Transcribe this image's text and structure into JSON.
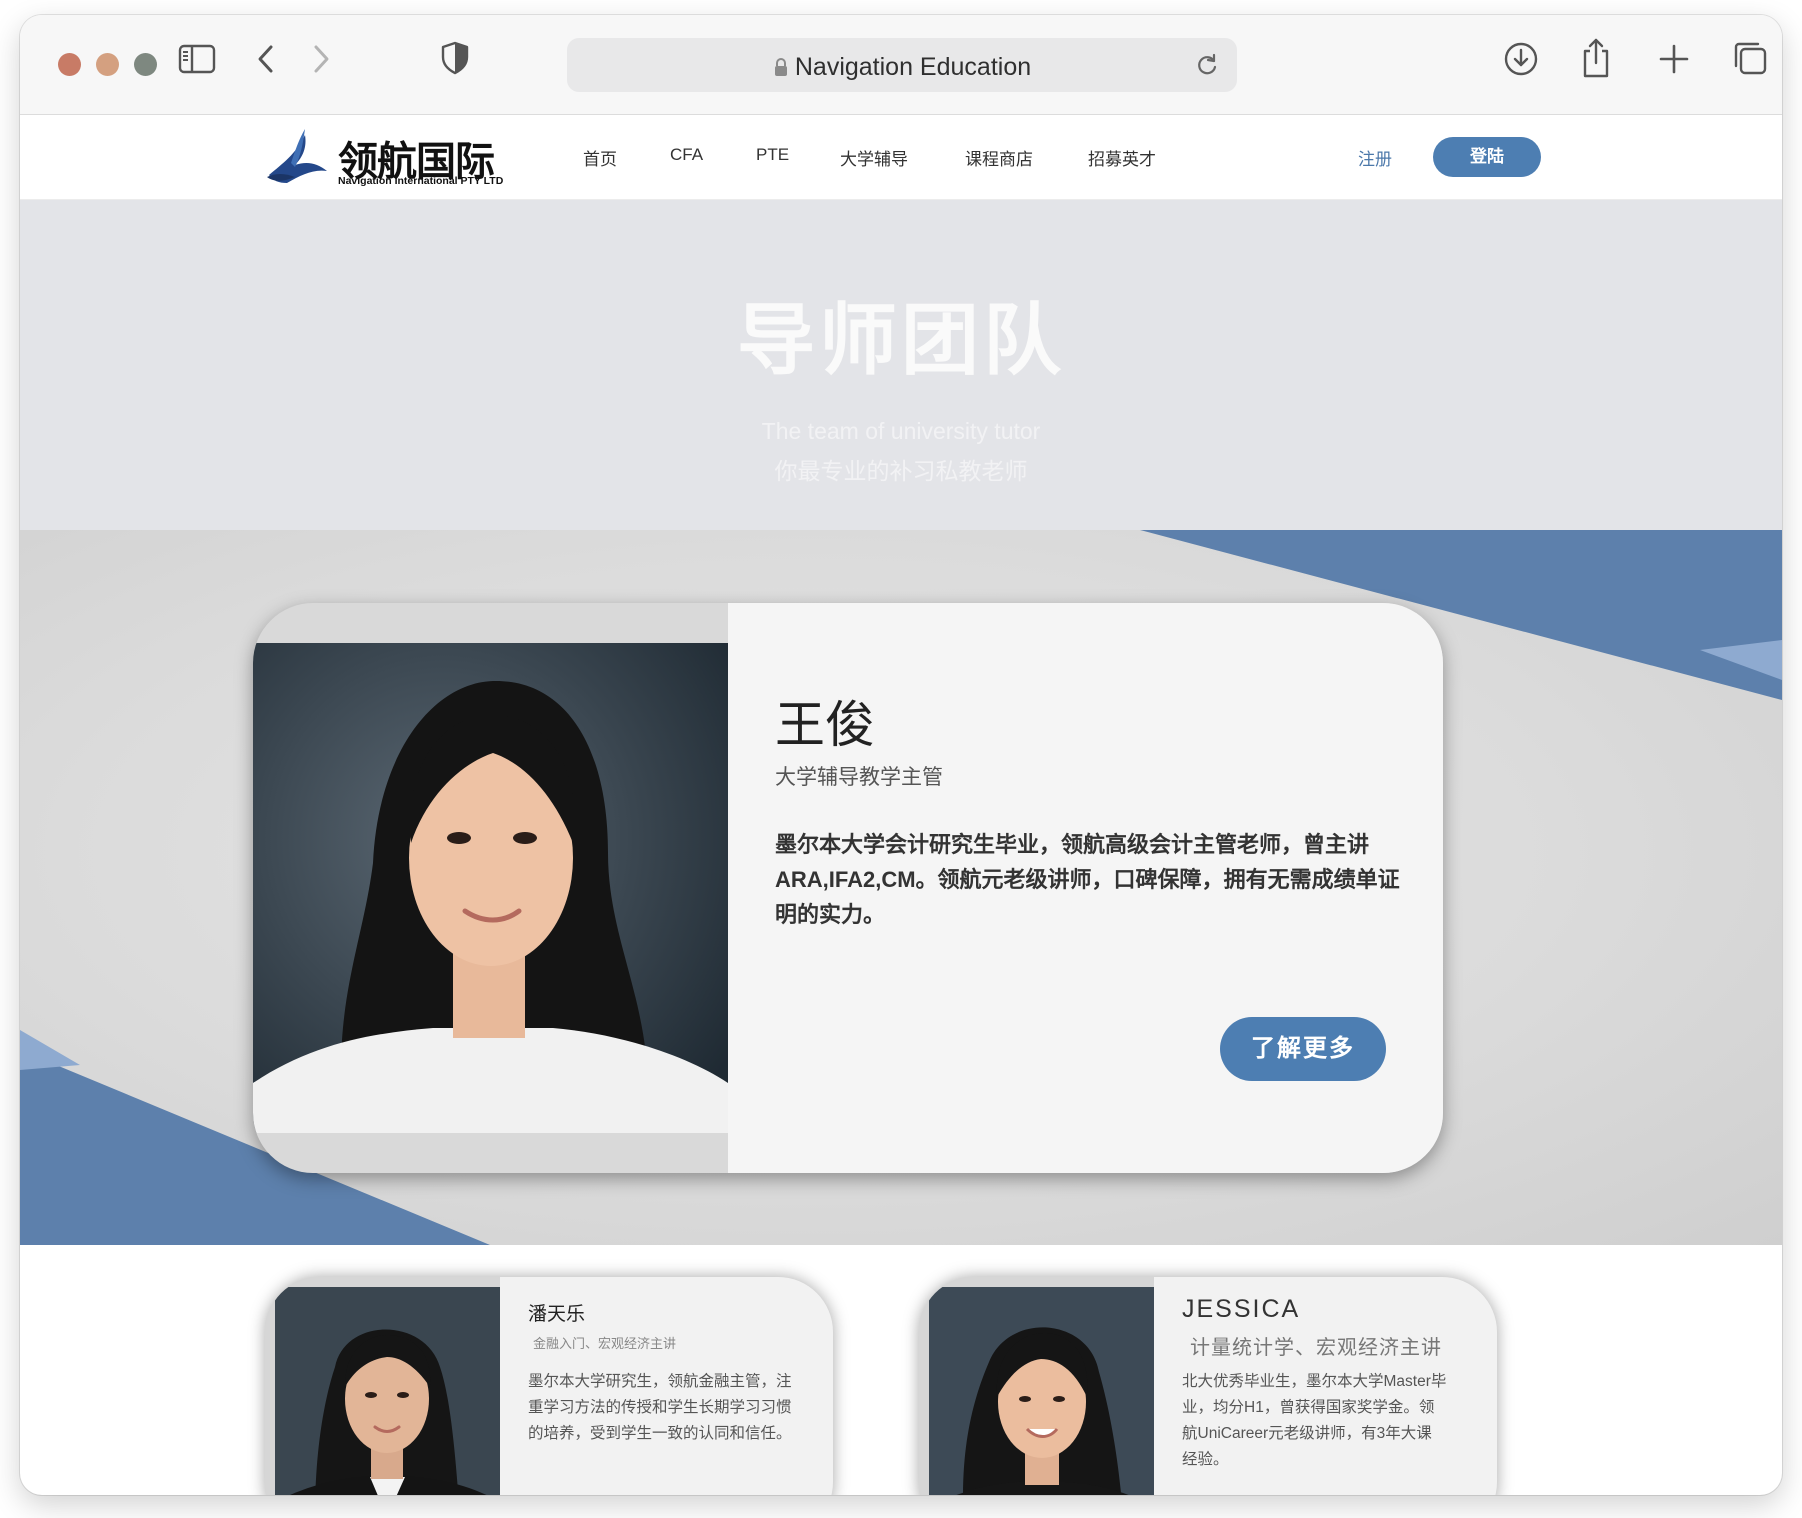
{
  "browser": {
    "url_display": "Navigation Education",
    "icons": [
      "sidebar-icon",
      "back-icon",
      "forward-icon",
      "shield-icon",
      "lock-icon",
      "reload-icon",
      "download-icon",
      "share-icon",
      "new-tab-icon",
      "tabs-overview-icon"
    ]
  },
  "site": {
    "logo_cn": "领航国际",
    "logo_en": "Navigation International PTY LTD",
    "nav": [
      "首页",
      "CFA",
      "PTE",
      "大学辅导",
      "课程商店",
      "招募英才"
    ],
    "register": "注册",
    "login": "登陆"
  },
  "hero": {
    "title": "导师团队",
    "subtitle_en": "The team of university tutor",
    "subtitle_cn": "你最专业的补习私教老师"
  },
  "featured_tutor": {
    "name": "王俊",
    "role": "大学辅导教学主管",
    "description": "墨尔本大学会计研究生毕业，领航高级会计主管老师，曾主讲ARA,IFA2,CM。领航元老级讲师，口碑保障，拥有无需成绩单证明的实力。",
    "button": "了解更多"
  },
  "tutors": [
    {
      "name": "潘天乐",
      "role": "金融入门、宏观经济主讲",
      "description": "墨尔本大学研究生，领航金融主管，注重学习方法的传授和学生长期学习习惯的培养，受到学生一致的认同和信任。"
    },
    {
      "name": "JESSICA",
      "role": "计量统计学、宏观经济主讲",
      "description": "北大优秀毕业生，墨尔本大学Master毕业，均分H1，曾获得国家奖学金。领航UniCareer元老级讲师，有3年大课经验。"
    }
  ],
  "colors": {
    "accent": "#4d7eb2",
    "hero_bg": "#e3e4e8",
    "deco_blue": "#5d80ac"
  }
}
